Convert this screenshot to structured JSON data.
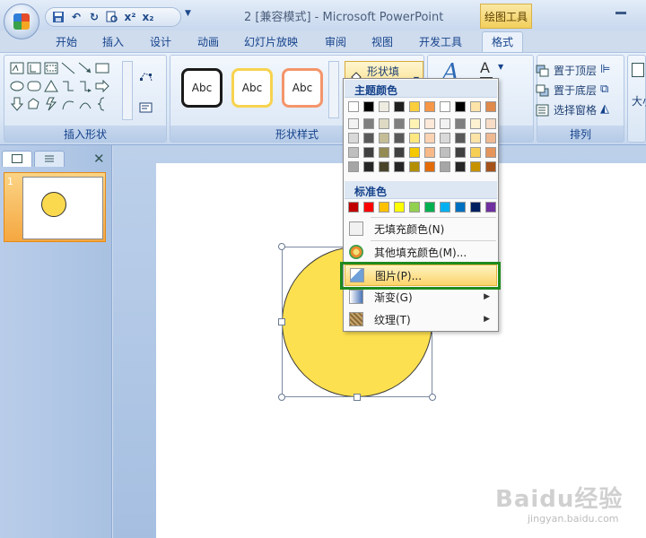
{
  "window": {
    "title": "2 [兼容模式] - Microsoft PowerPoint",
    "contextual_tool": "绘图工具"
  },
  "tabs": [
    "开始",
    "插入",
    "设计",
    "动画",
    "幻灯片放映",
    "审阅",
    "视图",
    "开发工具",
    "格式"
  ],
  "active_tab": "格式",
  "ribbon": {
    "insert_shapes_label": "插入形状",
    "shape_styles_label": "形状样式",
    "arrange_label": "排列",
    "style_sample_text": "Abc",
    "shape_fill_label": "形状填充",
    "bring_front": "置于顶层",
    "send_back": "置于底层",
    "selection_pane": "选择窗格",
    "size_partial": "大小"
  },
  "menu": {
    "theme_colors_header": "主题颜色",
    "standard_colors_header": "标准色",
    "no_fill": "无填充颜色(N)",
    "more_colors": "其他填充颜色(M)...",
    "picture": "图片(P)...",
    "gradient": "渐变(G)",
    "texture": "纹理(T)",
    "theme_top_row": [
      "#ffffff",
      "#000000",
      "#eeece1",
      "#1f1f1f",
      "#fbcf3c",
      "#f79646",
      "#ffffff",
      "#000000",
      "#fce4a8",
      "#e0894a"
    ],
    "theme_columns": [
      [
        "#f2f2f2",
        "#d9d9d9",
        "#bfbfbf",
        "#a6a6a6"
      ],
      [
        "#7f7f7f",
        "#595959",
        "#404040",
        "#262626"
      ],
      [
        "#ddd9c3",
        "#c4bd97",
        "#948a54",
        "#4a452a"
      ],
      [
        "#7f7f7f",
        "#595959",
        "#404040",
        "#262626"
      ],
      [
        "#fff2b3",
        "#ffe880",
        "#f5c800",
        "#b38f00"
      ],
      [
        "#fde9d9",
        "#fbd4b4",
        "#f7b988",
        "#e36c09"
      ],
      [
        "#f2f2f2",
        "#d9d9d9",
        "#bfbfbf",
        "#a6a6a6"
      ],
      [
        "#7f7f7f",
        "#595959",
        "#404040",
        "#262626"
      ],
      [
        "#fdf1d2",
        "#fbe4a6",
        "#f8cf55",
        "#c79200"
      ],
      [
        "#f7dcc8",
        "#efba92",
        "#e5955c",
        "#a5521a"
      ]
    ],
    "standard_colors": [
      "#c00000",
      "#ff0000",
      "#ffc000",
      "#ffff00",
      "#92d050",
      "#00b050",
      "#00b0f0",
      "#0070c0",
      "#002060",
      "#7030a0"
    ]
  },
  "slides_pane": {
    "slide_number": "1"
  },
  "shape": {
    "fill_color": "#fde050"
  },
  "watermark": {
    "main": "Baidu经验",
    "sub": "jingyan.baidu.com"
  },
  "icons": [
    "office-logo-icon",
    "save-icon",
    "undo-icon",
    "redo-icon",
    "print-preview-icon",
    "superscript-icon",
    "subscript-icon",
    "paint-bucket-icon",
    "picture-icon",
    "gradient-icon",
    "texture-icon",
    "palette-icon",
    "close-icon",
    "slides-tab-icon",
    "outline-tab-icon"
  ]
}
